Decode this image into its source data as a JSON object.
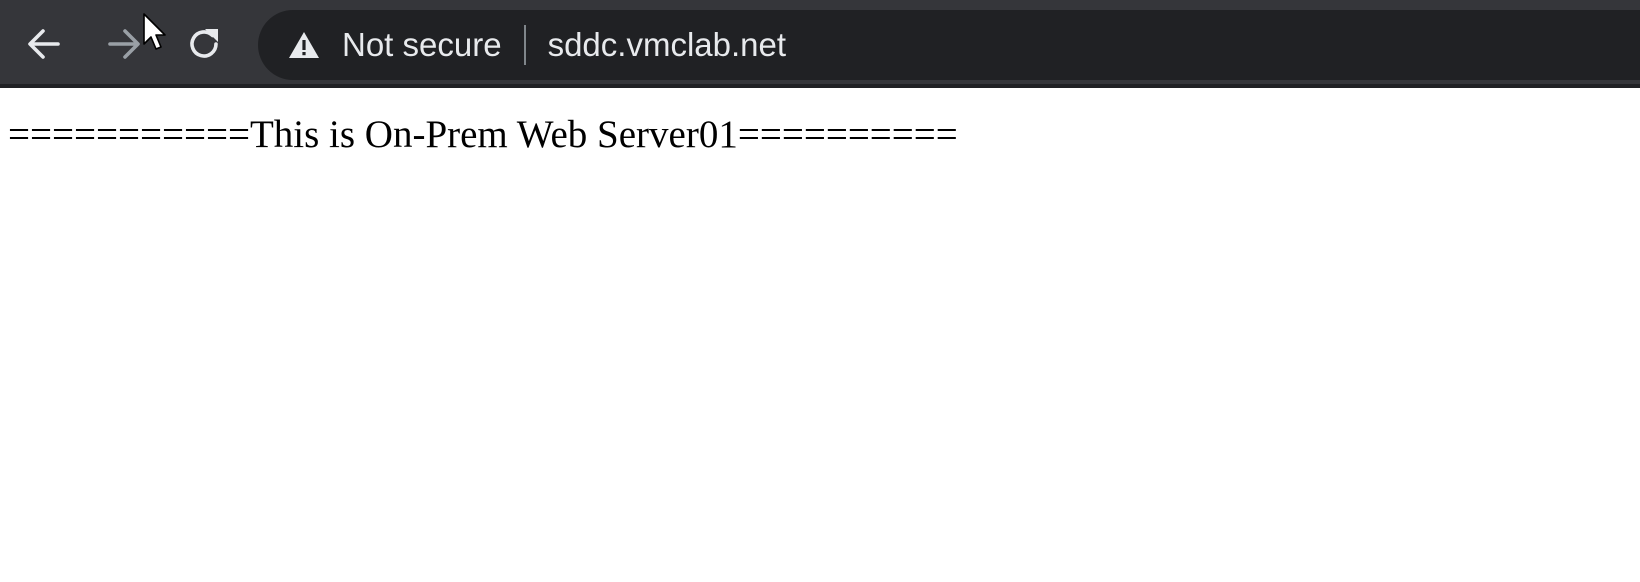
{
  "toolbar": {
    "back_icon": "arrow-left-icon",
    "forward_icon": "arrow-right-icon",
    "reload_icon": "reload-icon"
  },
  "omnibox": {
    "security_icon": "warning-triangle-icon",
    "security_label": "Not secure",
    "url": "sddc.vmclab.net"
  },
  "page": {
    "heading": "===========This is On-Prem Web Server01=========="
  },
  "colors": {
    "toolbar_bg": "#35363a",
    "omnibox_bg": "#202124",
    "toolbar_text": "#e8eaed",
    "forward_disabled": "#9aa0a6",
    "page_bg": "#ffffff",
    "page_text": "#000000"
  }
}
